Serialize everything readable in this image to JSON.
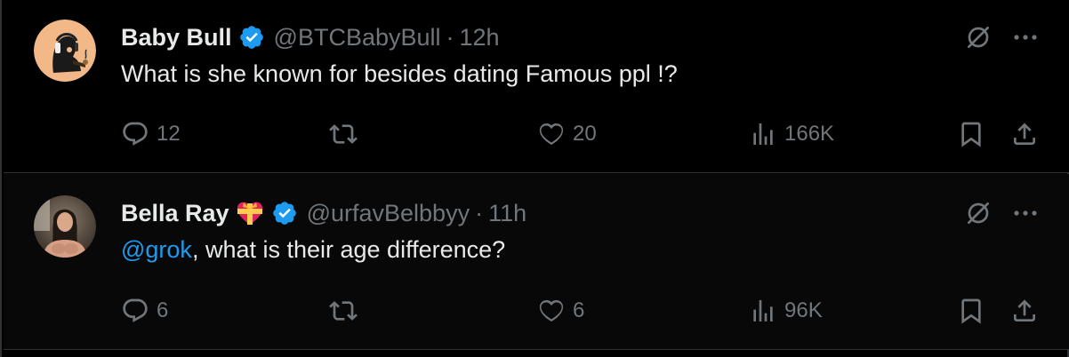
{
  "tweets": [
    {
      "author_name": "Baby Bull",
      "verified": true,
      "handle": "@BTCBabyBull",
      "separator": "·",
      "time": "12h",
      "text": "What is she known for besides dating Famous ppl !?",
      "mention": "",
      "stats": {
        "replies": "12",
        "retweets": "",
        "likes": "20",
        "views": "166K"
      },
      "avatar_bg": "#f3b888"
    },
    {
      "author_name": "Bella Ray",
      "verified": true,
      "badge_emoji": "heart-with-ribbon",
      "handle": "@urfavBelbbyy",
      "separator": "·",
      "time": "11h",
      "mention": "@grok",
      "text": ", what is their age difference?",
      "stats": {
        "replies": "6",
        "retweets": "",
        "likes": "6",
        "views": "96K"
      },
      "avatar_bg": "#6b5a4c"
    }
  ],
  "colors": {
    "background": "#000000",
    "text": "#e7e9ea",
    "muted": "#71767b",
    "accent": "#1d9bf0",
    "divider": "#2f3336"
  },
  "icons": [
    "reply-icon",
    "retweet-icon",
    "like-icon",
    "views-icon",
    "bookmark-icon",
    "share-icon",
    "grok-icon",
    "more-icon",
    "verified-badge-icon"
  ]
}
